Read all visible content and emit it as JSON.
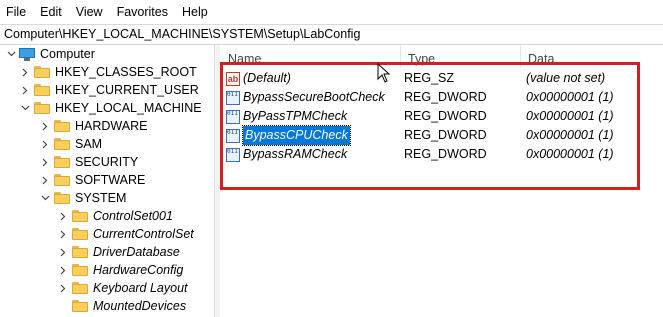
{
  "menu": [
    "File",
    "Edit",
    "View",
    "Favorites",
    "Help"
  ],
  "address": "Computer\\HKEY_LOCAL_MACHINE\\SYSTEM\\Setup\\LabConfig",
  "tree": [
    {
      "label": "Computer",
      "icon": "computer-icon",
      "chevron": "down",
      "level": 0
    },
    {
      "label": "HKEY_CLASSES_ROOT",
      "icon": "folder-icon",
      "chevron": "right",
      "level": 1
    },
    {
      "label": "HKEY_CURRENT_USER",
      "icon": "folder-icon",
      "chevron": "right",
      "level": 1
    },
    {
      "label": "HKEY_LOCAL_MACHINE",
      "icon": "folder-icon",
      "chevron": "down",
      "level": 1
    },
    {
      "label": "HARDWARE",
      "icon": "folder-icon",
      "chevron": "right",
      "level": 2
    },
    {
      "label": "SAM",
      "icon": "folder-icon",
      "chevron": "right",
      "level": 2
    },
    {
      "label": "SECURITY",
      "icon": "folder-icon",
      "chevron": "right",
      "level": 2
    },
    {
      "label": "SOFTWARE",
      "icon": "folder-icon",
      "chevron": "right",
      "level": 2
    },
    {
      "label": "SYSTEM",
      "icon": "folder-icon",
      "chevron": "down",
      "level": 2
    },
    {
      "label": "ControlSet001",
      "icon": "folder-icon",
      "chevron": "right",
      "level": 3
    },
    {
      "label": "CurrentControlSet",
      "icon": "folder-icon",
      "chevron": "right",
      "level": 3
    },
    {
      "label": "DriverDatabase",
      "icon": "folder-icon",
      "chevron": "right",
      "level": 3
    },
    {
      "label": "HardwareConfig",
      "icon": "folder-icon",
      "chevron": "right",
      "level": 3
    },
    {
      "label": "Keyboard Layout",
      "icon": "folder-icon",
      "chevron": "right",
      "level": 3
    },
    {
      "label": "MountedDevices",
      "icon": "folder-icon",
      "chevron": "none",
      "level": 3
    }
  ],
  "columns": {
    "name": "Name",
    "type": "Type",
    "data": "Data"
  },
  "values": [
    {
      "name": "(Default)",
      "type": "REG_SZ",
      "data": "(value not set)",
      "icon": "string-value-icon",
      "selected": false
    },
    {
      "name": "BypassSecureBootCheck",
      "type": "REG_DWORD",
      "data": "0x00000001 (1)",
      "icon": "dword-value-icon",
      "selected": false
    },
    {
      "name": "ByPassTPMCheck",
      "type": "REG_DWORD",
      "data": "0x00000001 (1)",
      "icon": "dword-value-icon",
      "selected": false
    },
    {
      "name": "BypassCPUCheck",
      "type": "REG_DWORD",
      "data": "0x00000001 (1)",
      "icon": "dword-value-icon",
      "selected": true
    },
    {
      "name": "BypassRAMCheck",
      "type": "REG_DWORD",
      "data": "0x00000001 (1)",
      "icon": "dword-value-icon",
      "selected": false
    }
  ],
  "string_icon_text": "ab",
  "dword_icon_text": "011 110",
  "colors": {
    "highlight_box": "#d21f26",
    "selection": "#0078d7"
  }
}
